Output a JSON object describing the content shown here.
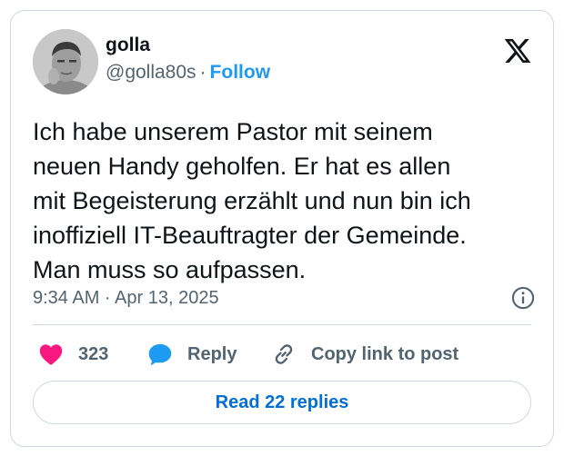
{
  "author": {
    "display_name": "golla",
    "handle": "@golla80s",
    "separator": "·",
    "follow_label": "Follow"
  },
  "tweet": {
    "text": "Ich habe unserem Pastor mit seinem\nneuen Handy geholfen. Er hat es allen\nmit Begeisterung erzählt und nun bin ich\ninoffiziell IT-Beauftragter der Gemeinde.\nMan muss so aufpassen.",
    "timestamp": "9:34 AM · Apr 13, 2025"
  },
  "actions": {
    "like_count": "323",
    "reply_label": "Reply",
    "copy_link_label": "Copy link to post"
  },
  "read_replies_label": "Read 22 replies",
  "colors": {
    "like": "#f91880",
    "reply": "#1d9bf0",
    "link": "#006fd6",
    "follow": "#1d9bf0",
    "muted": "#536471",
    "border": "#cfd9de"
  },
  "icons": {
    "logo": "x-logo-icon",
    "info": "info-icon",
    "like": "heart-icon",
    "reply": "speech-bubble-icon",
    "copy_link": "link-icon"
  }
}
